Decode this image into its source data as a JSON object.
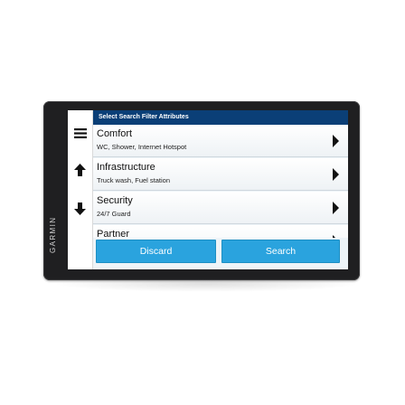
{
  "device": {
    "brand": "GARMIN"
  },
  "sidebar": {
    "items": [
      {
        "icon": "menu-icon"
      },
      {
        "icon": "arrow-up-icon"
      },
      {
        "icon": "arrow-down-icon"
      }
    ]
  },
  "panel": {
    "title": "Select Search Filter Attributes",
    "rows": [
      {
        "title": "Comfort",
        "subtitle": "WC, Shower, Internet Hotspot"
      },
      {
        "title": "Infrastructure",
        "subtitle": "Truck wash, Fuel station"
      },
      {
        "title": "Security",
        "subtitle": "24/7 Guard"
      },
      {
        "title": "Partner",
        "subtitle": ""
      }
    ]
  },
  "buttons": {
    "discard_label": "Discard",
    "search_label": "Search"
  },
  "colors": {
    "title_bar": "#0b3f77",
    "button": "#2aa3de",
    "bezel": "#1f1f21"
  }
}
